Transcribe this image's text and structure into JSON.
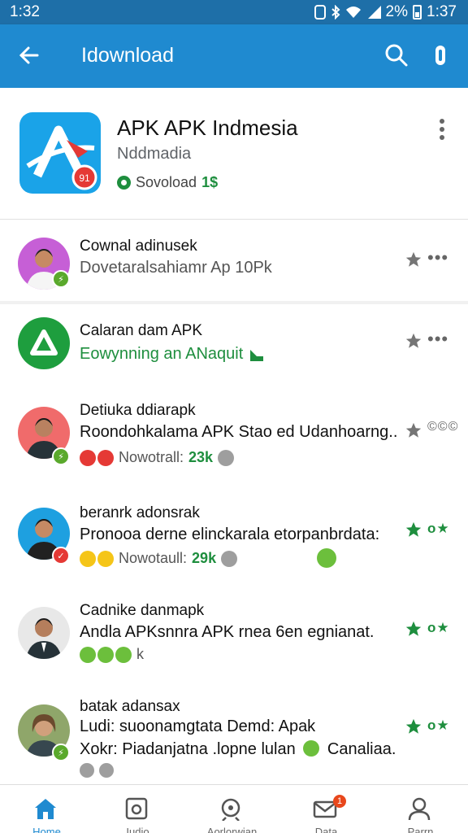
{
  "status_bar": {
    "time_left": "1:32",
    "battery_pct": "2%",
    "time_right": "1:37"
  },
  "app_bar": {
    "title": "Idownload",
    "icons": [
      "back-arrow-icon",
      "search-icon",
      "more-vert-icon"
    ]
  },
  "app_header": {
    "title": "APK APK Indmesia",
    "subtitle": "Nddmadia",
    "download_label": "Sovoload",
    "download_count": "1$",
    "brand_color": "#1aa3e8",
    "icon_badge": "91"
  },
  "feed": [
    {
      "name": "Cownal adinusek",
      "line1": "Dovetaralsahiamr Ap 10Pk",
      "badge": "green",
      "star_color": "#757575",
      "more": "•••"
    },
    {
      "name": "Calaran dam APK",
      "line1": "Eowynning an ANaquit",
      "star_color": "#757575",
      "more": "•••"
    },
    {
      "name": "Detiuka ddiarapk",
      "line1": "Roondohkalama APK Stao ed Udanhoarng..",
      "meta_label": "Nowotrall:",
      "meta_count": "23k",
      "badge": "green",
      "star_color": "#757575",
      "more": "©©©"
    },
    {
      "name": "beranrk adonsrak",
      "line1": "Pronooa derne elinckarala etorpanbrdata:",
      "meta_label": "Nowotaull:",
      "meta_count": "29k",
      "badge": "red",
      "star_color": "#1e8e3e",
      "more": "o★"
    },
    {
      "name": "Cadnike danmapk",
      "line1": "Andla APKsnnra APK rnea 6en egnianat.",
      "meta_label": "k",
      "star_color": "#1e8e3e",
      "more": "o★"
    },
    {
      "name": "batak adansax",
      "line1": "Ludi: suoonamgtata Demd: Apak",
      "line2": "Xokr: Piadanjatna .lopne lulan",
      "line2_end": "Canaliaa.",
      "badge": "green",
      "star_color": "#1e8e3e",
      "more": "o★"
    }
  ],
  "bottom_nav": [
    {
      "label": "Home",
      "icon": "home-icon",
      "active": true
    },
    {
      "label": "Iudio",
      "icon": "library-icon"
    },
    {
      "label": "Aorlorwian",
      "icon": "search-icon"
    },
    {
      "label": "Data",
      "icon": "mail-icon",
      "badge": "1"
    },
    {
      "label": "Parrn",
      "icon": "person-icon"
    }
  ],
  "colors": {
    "app_bar": "#1f8ad0",
    "status_bar": "#1e6fa8",
    "accent_green": "#1e8e3e"
  }
}
